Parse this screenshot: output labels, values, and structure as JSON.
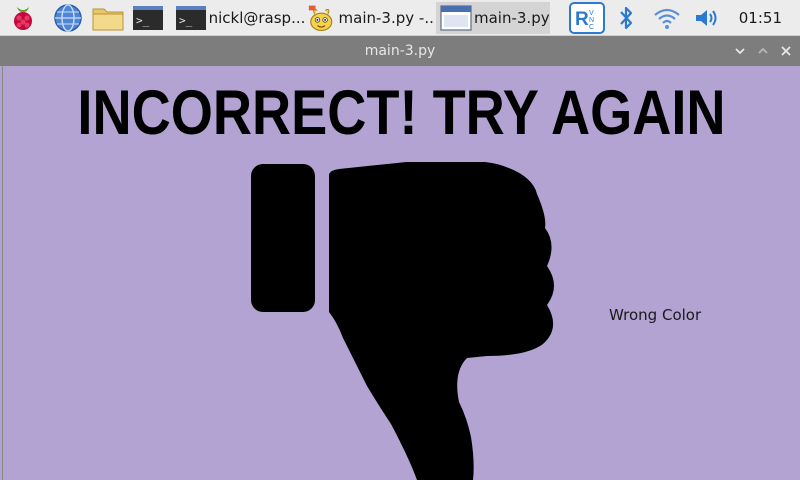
{
  "taskbar": {
    "tasks": [
      {
        "label": "nickl@rasp..."
      },
      {
        "label": "main-3.py -..."
      },
      {
        "label": "main-3.py"
      }
    ],
    "clock": "01:51",
    "terminal_glyph": ">_"
  },
  "window": {
    "title": "main-3.py"
  },
  "app": {
    "headline": "INCORRECT! TRY AGAIN",
    "status": "Wrong Color",
    "icon": "thumbs-down-icon",
    "background_color": "#b3a3d3"
  }
}
